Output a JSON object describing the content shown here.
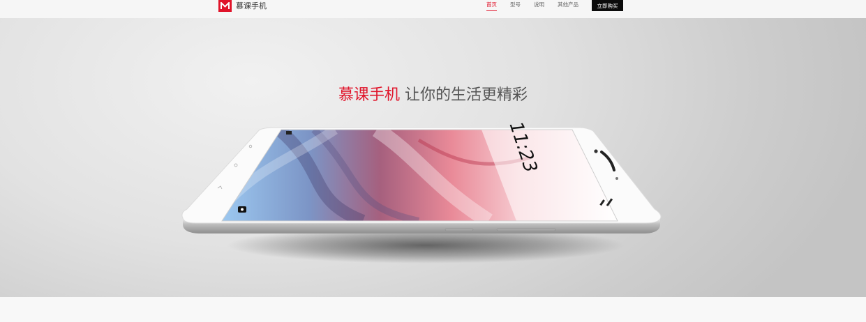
{
  "header": {
    "logo_text": "慕课手机",
    "nav": [
      {
        "label": "首页",
        "active": true
      },
      {
        "label": "型号",
        "active": false
      },
      {
        "label": "说明",
        "active": false
      },
      {
        "label": "其他产品",
        "active": false
      }
    ],
    "buy_button": "立即购买"
  },
  "hero": {
    "headline_brand": "慕课手机",
    "headline_slogan": "让你的生活更精彩",
    "phone_screen_time": "11:23"
  },
  "colors": {
    "accent": "#e0142a",
    "button_bg": "#0b0b0b"
  }
}
